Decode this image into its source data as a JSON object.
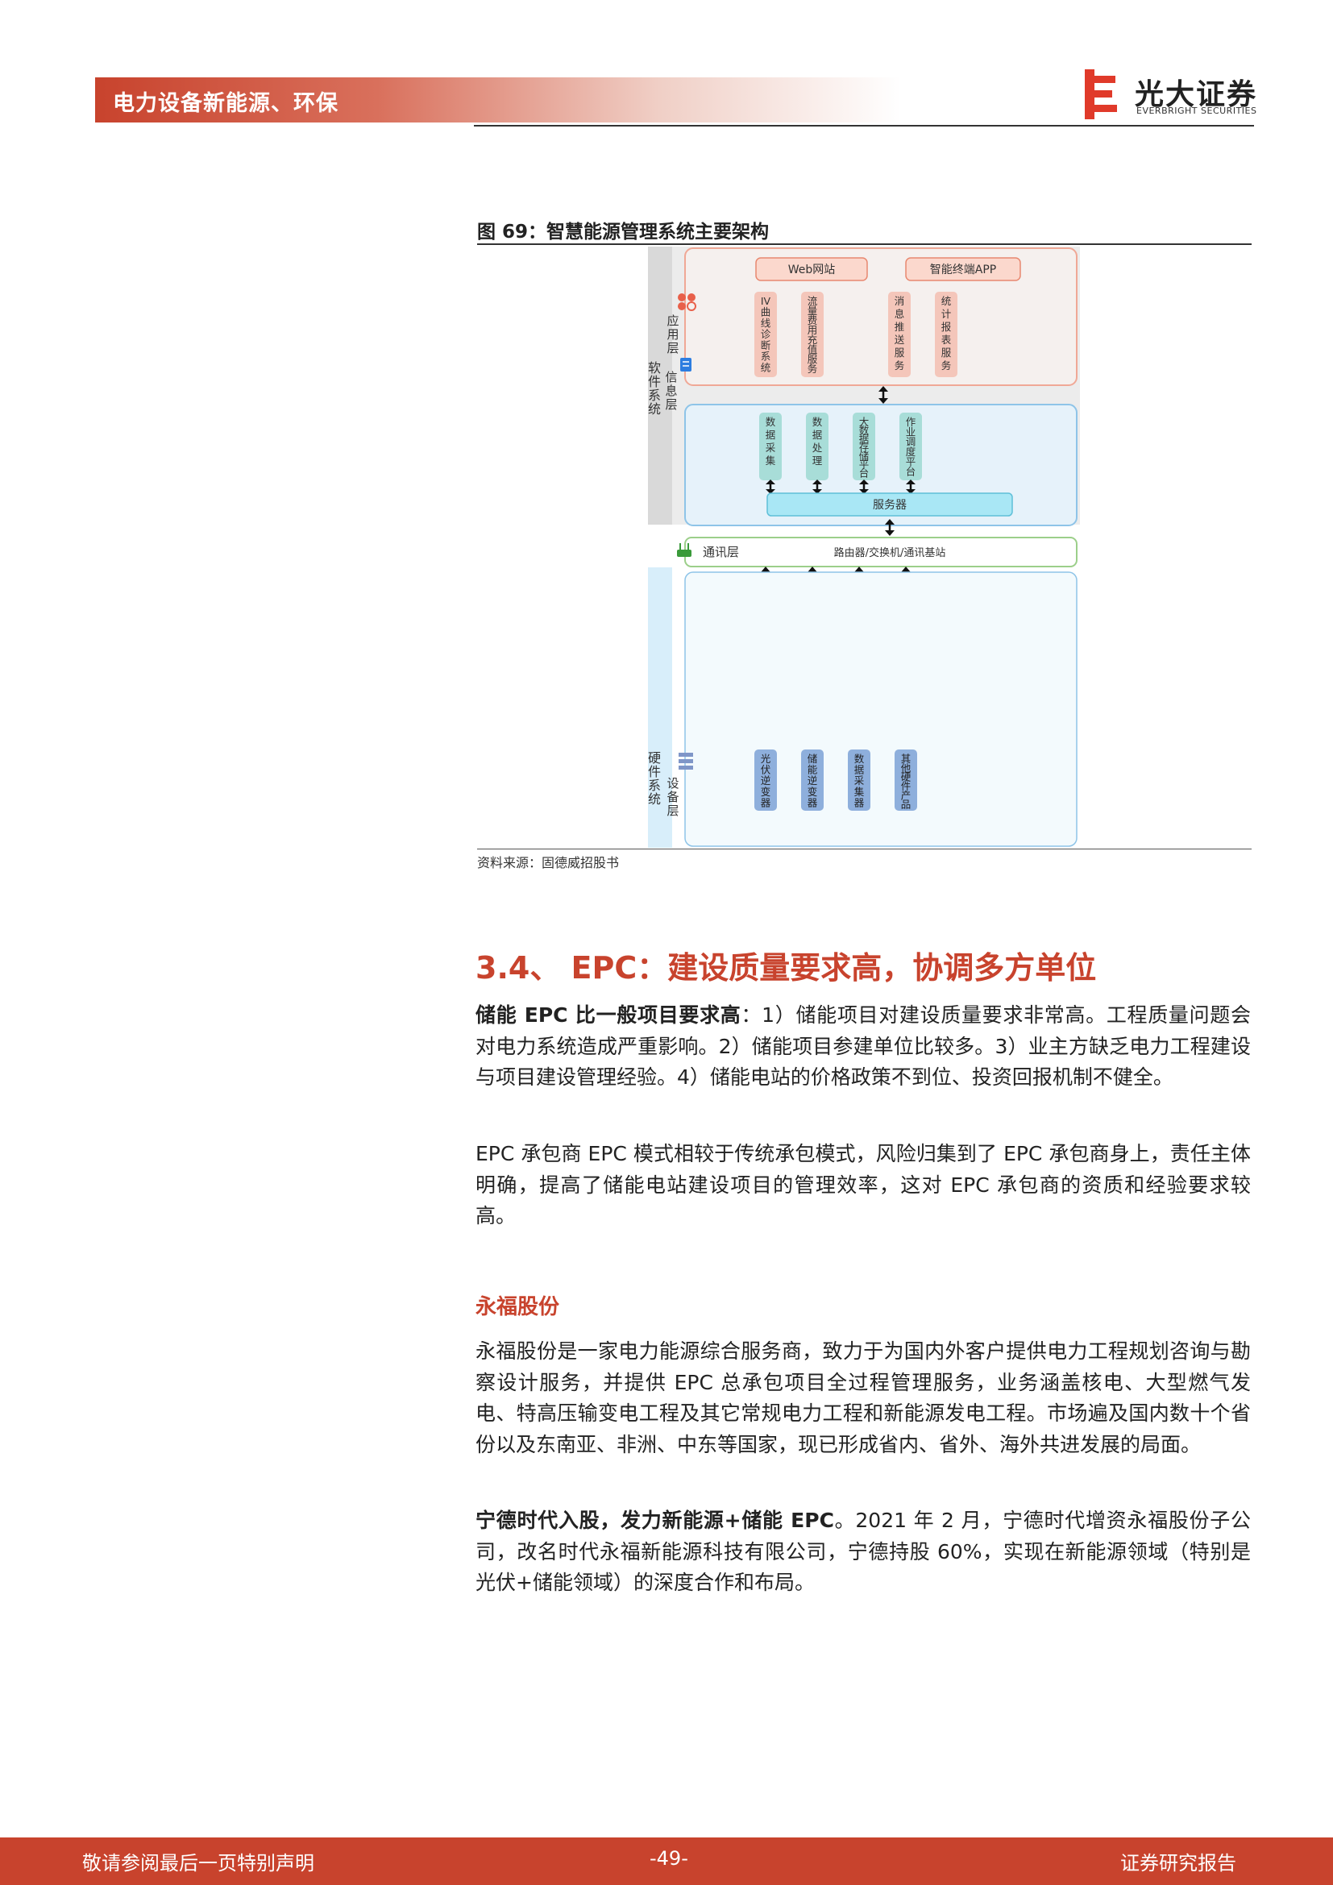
{
  "header": {
    "category": "电力设备新能源、环保",
    "logo_cn": "光大证券",
    "logo_en": "EVERBRIGHT SECURITIES"
  },
  "figure": {
    "title": "图 69：智慧能源管理系统主要架构",
    "source": "资料来源：固德威招股书",
    "diagram": {
      "software_label": "软件系统",
      "hardware_label": "硬件系统",
      "app_layer": {
        "label": "应用层",
        "top_boxes": [
          "Web网站",
          "智能终端APP"
        ],
        "columns": [
          "IV曲线诊断系统",
          "流量费用充值服务",
          "消息推送服务",
          "统计报表服务"
        ]
      },
      "info_layer": {
        "label": "信息层",
        "columns": [
          "数据采集",
          "数据处理",
          "大数据存储平台",
          "作业调度平台"
        ],
        "server": "服务器"
      },
      "comm_layer": {
        "label": "通讯层",
        "content": "路由器/交换机/通讯基站"
      },
      "device_layer": {
        "label": "设备层",
        "columns": [
          "光伏逆变器",
          "储能逆变器",
          "数据采集器",
          "其他硬件产品"
        ]
      },
      "colors": {
        "app_border": "#f0a896",
        "app_fill": "#f5f0ee",
        "info_border": "#8ec4e8",
        "info_fill": "#e6f2fa",
        "comm_border": "#9ccf8a",
        "device_fill": "#eaf6fc",
        "device_col": "#8eafdc",
        "software_band": "#d9d9d9",
        "hardware_band": "#d8eefa"
      }
    }
  },
  "section": {
    "title": "3.4、  EPC：建设质量要求高，协调多方单位",
    "p1_bold": "储能 EPC 比一般项目要求高",
    "p1_rest": "：1）储能项目对建设质量要求非常高。工程质量问题会对电力系统造成严重影响。2）储能项目参建单位比较多。3）业主方缺乏电力工程建设与项目建设管理经验。4）储能电站的价格政策不到位、投资回报机制不健全。",
    "p2": "EPC 承包商 EPC 模式相较于传统承包模式，风险归集到了 EPC 承包商身上，责任主体明确，提高了储能电站建设项目的管理效率，这对 EPC 承包商的资质和经验要求较高。",
    "company": "永福股份",
    "p3": "永福股份是一家电力能源综合服务商，致力于为国内外客户提供电力工程规划咨询与勘察设计服务，并提供 EPC 总承包项目全过程管理服务，业务涵盖核电、大型燃气发电、特高压输变电工程及其它常规电力工程和新能源发电工程。市场遍及国内数十个省份以及东南亚、非洲、中东等国家，现已形成省内、省外、海外共进发展的局面。",
    "p4_bold": "宁德时代入股，发力新能源+储能 EPC",
    "p4_rest": "。2021 年 2 月，宁德时代增资永福股份子公司，改名时代永福新能源科技有限公司，宁德持股 60%，实现在新能源领域（特别是光伏+储能领域）的深度合作和布局。"
  },
  "footer": {
    "disclaimer": "敬请参阅最后一页特别声明",
    "page": "-49-",
    "report_type": "证券研究报告"
  }
}
